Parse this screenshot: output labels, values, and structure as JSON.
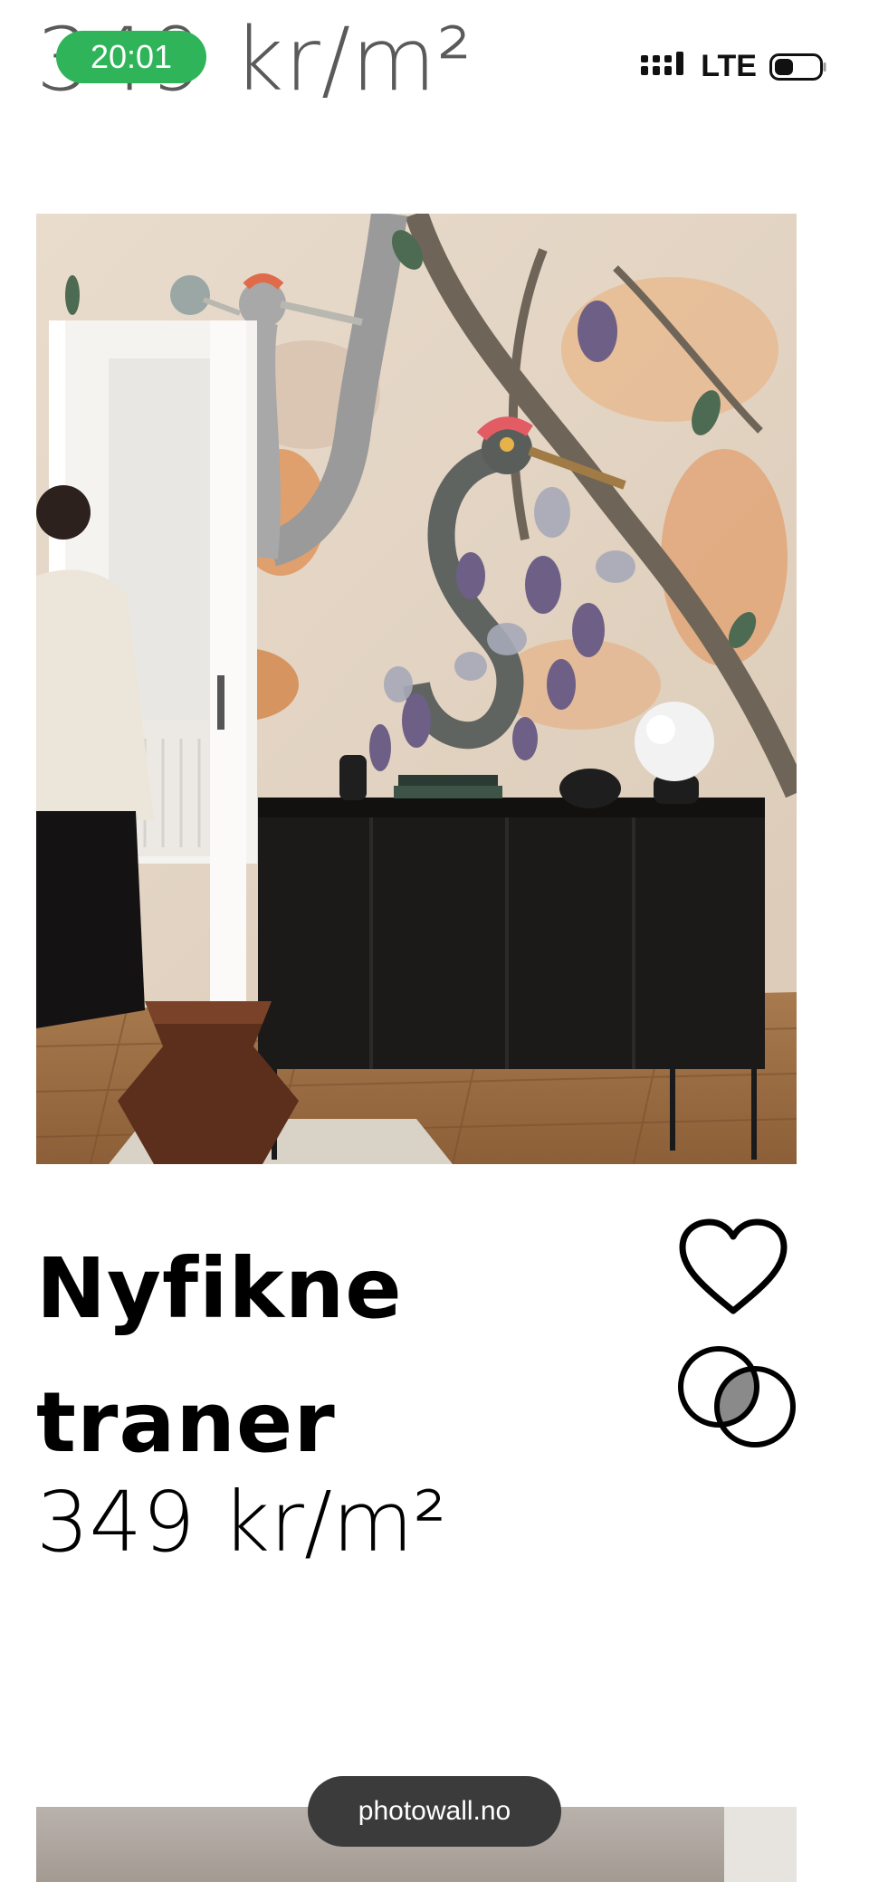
{
  "status_bar": {
    "time": "20:01",
    "network": "LTE",
    "signal_icon": "signal-bars-icon",
    "battery_icon": "battery-icon"
  },
  "sticky_header": {
    "partial_price": "349 kr/m²"
  },
  "product": {
    "image_alt_name": "wallpaper-room-photo",
    "title_line1": "Nyfikne",
    "title_line2": "traner",
    "price": "349 kr/m²",
    "favorite_icon": "heart-icon",
    "compare_icon": "compare-circles-icon"
  },
  "browser": {
    "url": "photowall.no"
  },
  "colors": {
    "status_pill": "#2fb45a",
    "url_pill": "#3b3b3b"
  }
}
